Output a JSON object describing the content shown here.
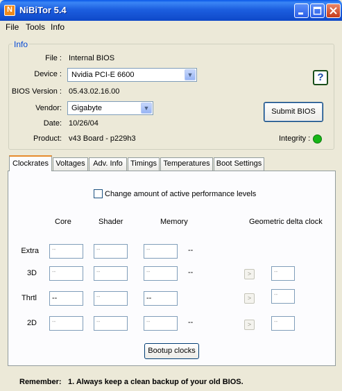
{
  "window": {
    "title": "NiBiTor 5.4",
    "icon_letter": "N"
  },
  "menu": [
    "File",
    "Tools",
    "Info"
  ],
  "info": {
    "legend": "Info",
    "file_label": "File :",
    "file_value": "Internal BIOS",
    "device_label": "Device :",
    "device_value": "Nvidia PCI-E 6600",
    "bios_label": "BIOS Version :",
    "bios_value": "05.43.02.16.00",
    "vendor_label": "Vendor:",
    "vendor_value": "Gigabyte",
    "date_label": "Date:",
    "date_value": "10/26/04",
    "product_label": "Product:",
    "product_value": "v43 Board - p229h3",
    "help_glyph": "?",
    "submit_label": "Submit BIOS",
    "integrity_label": "Integrity :",
    "integrity_color": "#17b617"
  },
  "tabs": [
    "Clockrates",
    "Voltages",
    "Adv. Info",
    "Timings",
    "Temperatures",
    "Boot Settings"
  ],
  "active_tab": "Clockrates",
  "clockrates": {
    "perf_checkbox_label": "Change amount of active performance levels",
    "perf_checked": false,
    "headers": {
      "core": "Core",
      "shader": "Shader",
      "memory": "Memory",
      "delta": "Geometric delta clock"
    },
    "rows": [
      {
        "label": "Extra",
        "core": "--",
        "shader": "--",
        "memory": "--",
        "extra": "--"
      },
      {
        "label": "3D",
        "core": "--",
        "shader": "--",
        "memory": "--",
        "delta": "--"
      },
      {
        "label": "Thrtl",
        "core": "--",
        "shader": "--",
        "memory": "--",
        "delta": "--"
      },
      {
        "label": "2D",
        "core": "--",
        "shader": "--",
        "memory": "--",
        "delta": "--"
      }
    ],
    "arrow_glyph": ">",
    "bootup_label": "Bootup clocks"
  },
  "footer": {
    "remember_label": "Remember:",
    "remember_text": "1. Always keep a clean backup of your old BIOS."
  }
}
